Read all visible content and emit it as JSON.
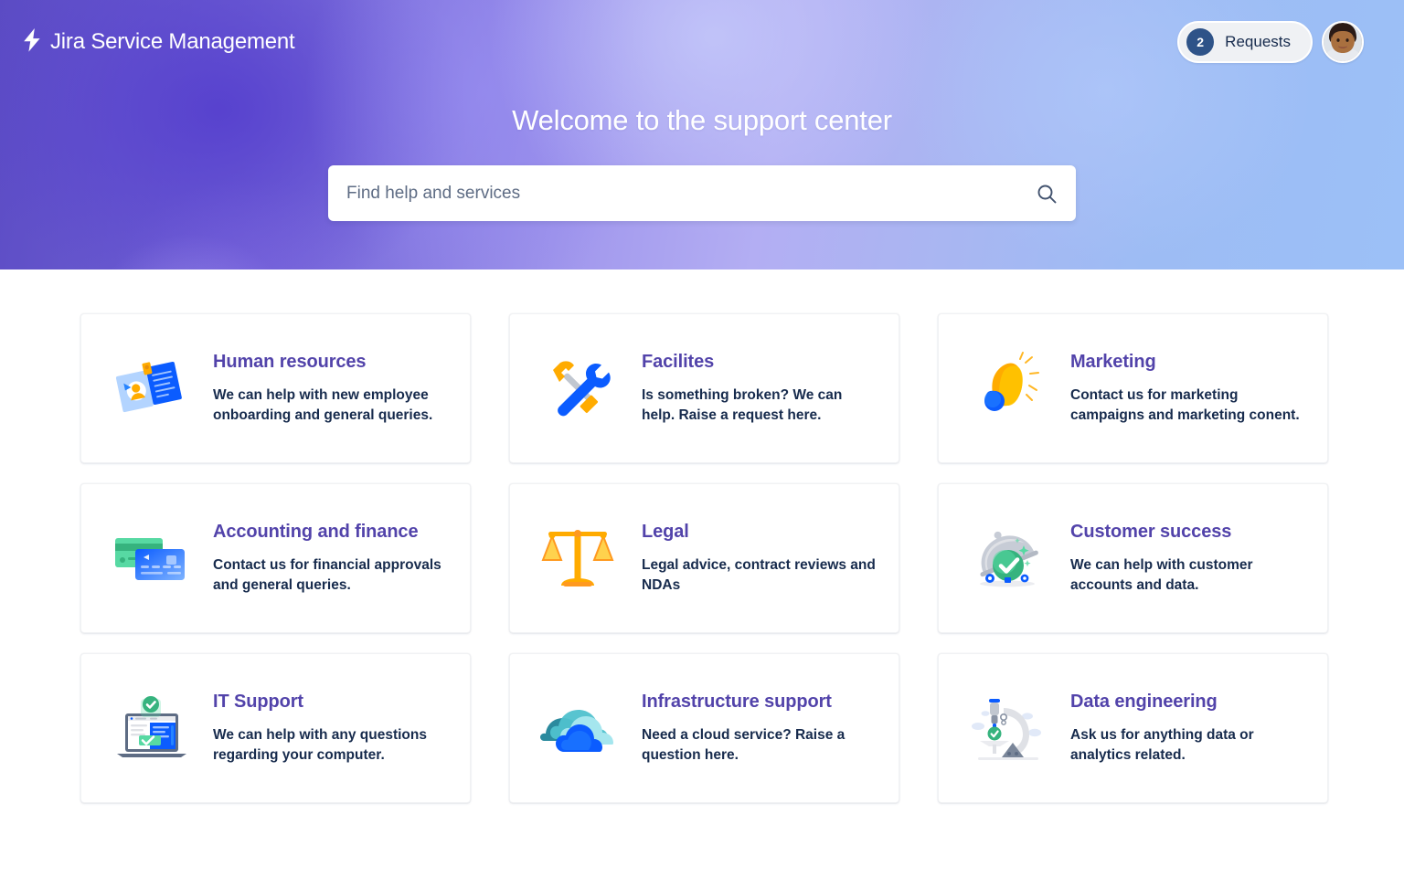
{
  "header": {
    "brand_name": "Jira Service Management",
    "logo_icon": "lightning-bolt-icon",
    "requests_count": "2",
    "requests_label": "Requests",
    "avatar_alt": "user-avatar"
  },
  "hero": {
    "title": "Welcome to the support center",
    "search_placeholder": "Find help and services",
    "search_value": "",
    "search_icon": "search-icon",
    "gradient_from": "#5B4BC4",
    "gradient_to": "#9CC0F7"
  },
  "colors": {
    "card_title": "#5243AA",
    "card_text": "#172B4D",
    "badge_bg": "#2E5388",
    "card_bg": "#FFFFFF"
  },
  "cards": [
    {
      "title": "Human resources",
      "desc": "We can help with new employee onboarding and general queries.",
      "icon": "id-badge-icon"
    },
    {
      "title": "Facilites",
      "desc": "Is something broken? We can help. Raise a request here.",
      "icon": "hammer-wrench-icon"
    },
    {
      "title": "Marketing",
      "desc": "Contact us for marketing campaigns and marketing conent.",
      "icon": "megaphone-icon"
    },
    {
      "title": "Accounting and finance",
      "desc": "Contact us for financial approvals and general queries.",
      "icon": "credit-cards-icon"
    },
    {
      "title": "Legal",
      "desc": "Legal advice, contract reviews and NDAs",
      "icon": "scales-of-justice-icon"
    },
    {
      "title": "Customer success",
      "desc": "We can help with customer accounts and data.",
      "icon": "cloche-checkmark-icon"
    },
    {
      "title": "IT Support",
      "desc": "We can help with any questions regarding your computer.",
      "icon": "laptop-check-icon"
    },
    {
      "title": "Infrastructure support",
      "desc": "Need a cloud service? Raise a question here.",
      "icon": "clouds-icon"
    },
    {
      "title": "Data engineering",
      "desc": "Ask us for anything data or analytics related.",
      "icon": "microscope-icon"
    }
  ]
}
